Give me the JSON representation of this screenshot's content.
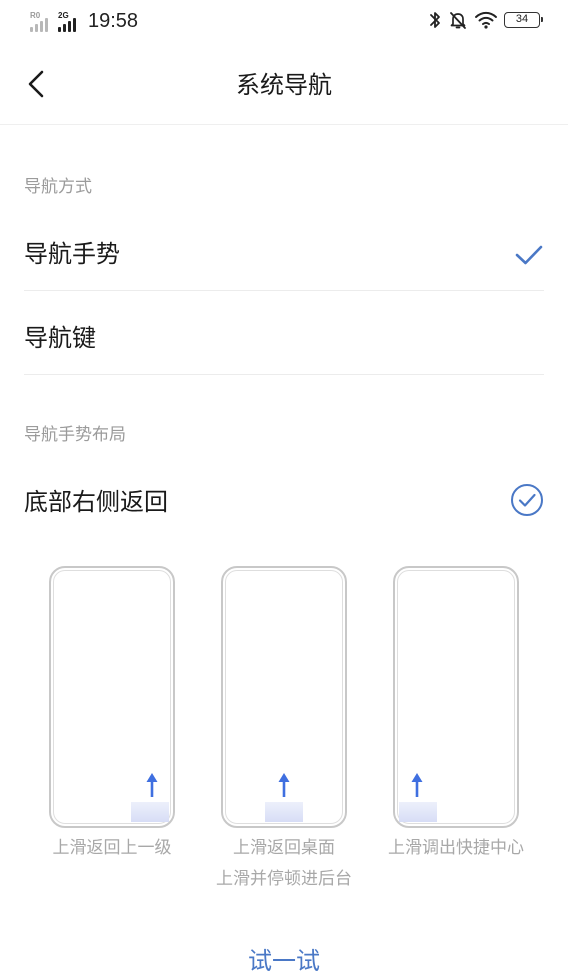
{
  "status_bar": {
    "sim1_tag": "R0",
    "sim2_tag": "2G",
    "time": "19:58",
    "battery": "34"
  },
  "header": {
    "title": "系统导航"
  },
  "navigation_method": {
    "section_title": "导航方式",
    "options": [
      {
        "label": "导航手势",
        "selected": true
      },
      {
        "label": "导航键",
        "selected": false
      }
    ]
  },
  "gesture_layout": {
    "section_title": "导航手势布局",
    "current": "底部右侧返回"
  },
  "previews": [
    {
      "caption": "上滑返回上一级",
      "position": "right"
    },
    {
      "caption": "上滑返回桌面",
      "caption2": "上滑并停顿进后台",
      "position": "center"
    },
    {
      "caption": "上滑调出快捷中心",
      "position": "left"
    }
  ],
  "try_button": {
    "label": "试一试"
  },
  "colors": {
    "accent": "#4a78c6",
    "arrow": "#3f6fe0",
    "secondary_text": "#9b9b9b"
  }
}
